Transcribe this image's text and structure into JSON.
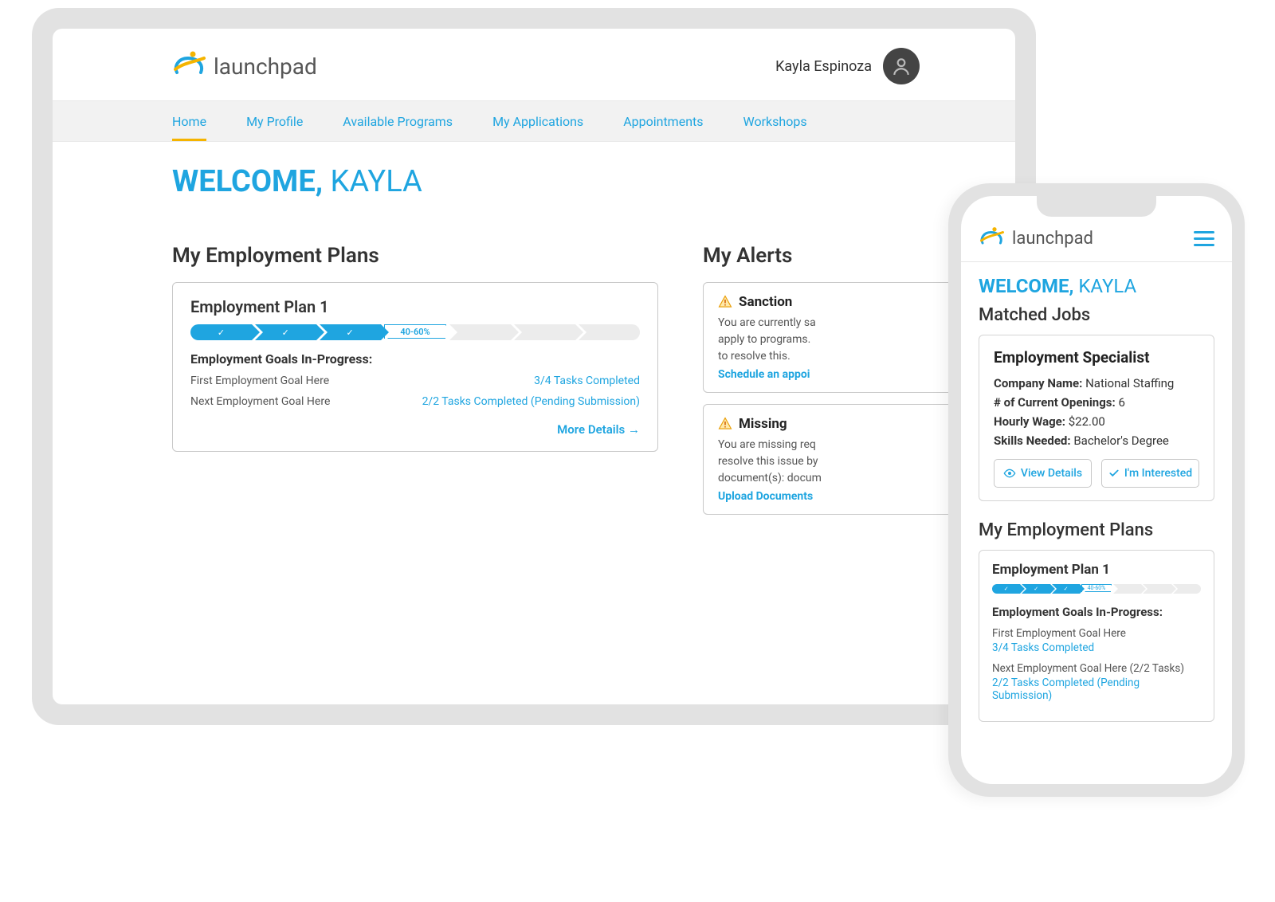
{
  "brand": {
    "name": "launchpad"
  },
  "user": {
    "name": "Kayla Espinoza",
    "first_name_upper": "KAYLA"
  },
  "nav": {
    "items": [
      {
        "label": "Home",
        "active": true
      },
      {
        "label": "My Profile"
      },
      {
        "label": "Available Programs"
      },
      {
        "label": "My Applications"
      },
      {
        "label": "Appointments"
      },
      {
        "label": "Workshops"
      }
    ]
  },
  "welcome": {
    "word": "WELCOME,"
  },
  "sections": {
    "plans": "My Employment Plans",
    "alerts": "My Alerts",
    "matched_jobs": "Matched Jobs"
  },
  "plan": {
    "title": "Employment Plan 1",
    "progress_label": "40-60%",
    "goals_heading": "Employment Goals In-Progress:",
    "goals": [
      {
        "name": "First Employment Goal Here",
        "status": "3/4 Tasks Completed"
      },
      {
        "name": "Next Employment Goal Here",
        "status": "2/2 Tasks Completed (Pending Submission)"
      }
    ],
    "more": "More Details →"
  },
  "alerts": [
    {
      "title": "Sanction",
      "body1": "You are currently sa",
      "body2": "apply to programs.",
      "body3": "to resolve this.",
      "link": "Schedule an appoi"
    },
    {
      "title": "Missing",
      "body1": "You are missing req",
      "body2": "resolve this issue by",
      "body3": "document(s): docum",
      "link": "Upload Documents"
    }
  ],
  "mobile": {
    "job": {
      "title": "Employment Specialist",
      "company_label": "Company Name:",
      "company": "National Staffing",
      "openings_label": "# of Current Openings:",
      "openings": "6",
      "wage_label": "Hourly Wage:",
      "wage": "$22.00",
      "skills_label": "Skills Needed:",
      "skills": "Bachelor's Degree",
      "view_details": "View Details",
      "interested": "I'm Interested"
    },
    "plan_goals": [
      {
        "name": "First Employment Goal Here",
        "status": "3/4 Tasks Completed"
      },
      {
        "name": "Next Employment Goal Here (2/2 Tasks)",
        "status": "2/2 Tasks Completed (Pending Submission)"
      }
    ]
  }
}
